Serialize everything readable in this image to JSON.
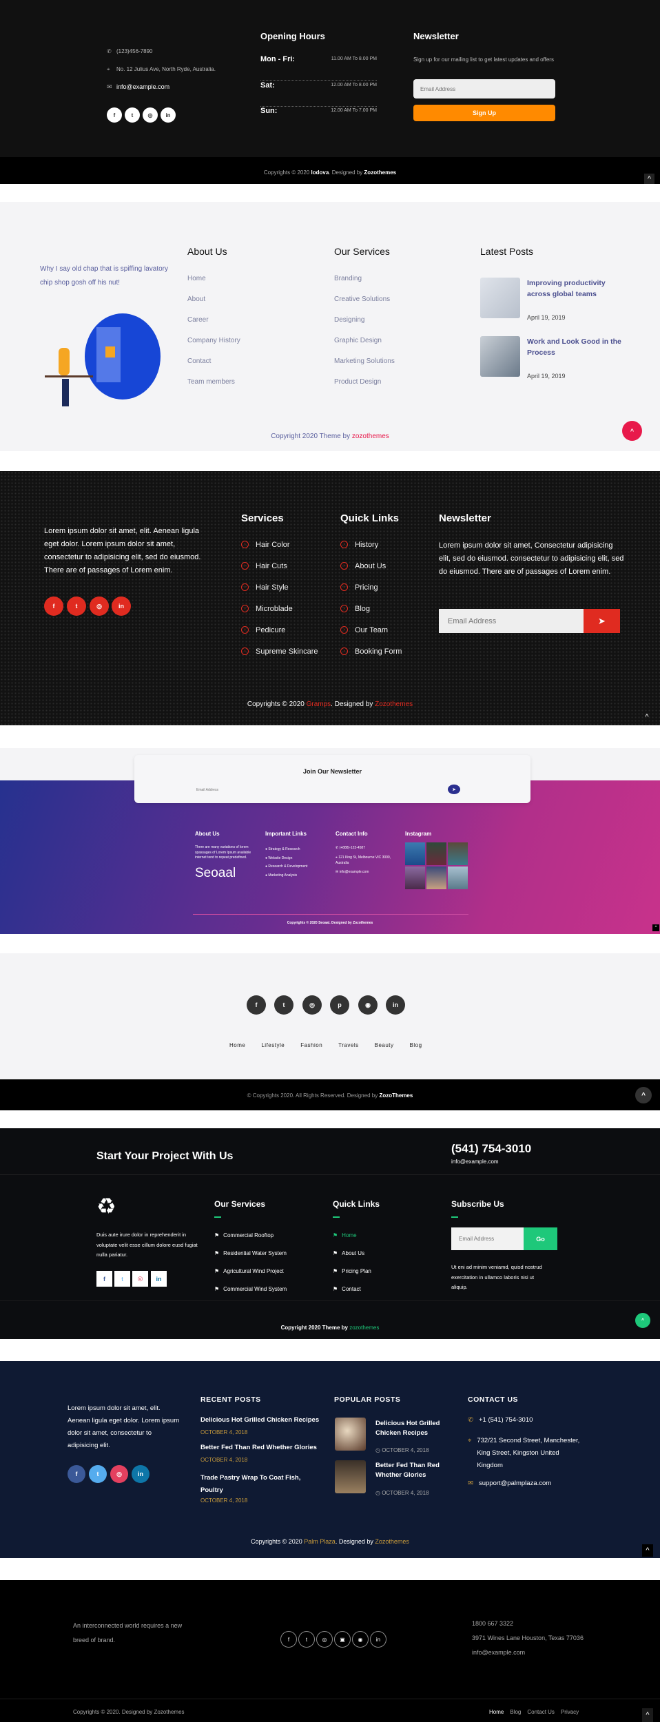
{
  "footer1": {
    "phone": "(123)456-7890",
    "address": "No. 12 Julius Ave, North Ryde, Australia.",
    "email": "info@example.com",
    "social": [
      "f",
      "t",
      "ig",
      "in"
    ],
    "hours_title": "Opening Hours",
    "hours": [
      {
        "day": "Mon - Fri:",
        "time": "11.00 AM To 8.00 PM"
      },
      {
        "day": "Sat:",
        "time": "12.00 AM To 8.00 PM"
      },
      {
        "day": "Sun:",
        "time": "12.00 AM To 7.00 PM"
      }
    ],
    "newsletter_title": "Newsletter",
    "newsletter_text": "Sign up for our mailing list to get latest updates and offers",
    "email_placeholder": "Email Address",
    "signup": "Sign Up",
    "copy_pre": "Copyrights © 2020 ",
    "copy_brand": "lodova",
    "copy_mid": ". Designed by ",
    "copy_designer": "Zozothemes",
    "accent": "#ff8a00"
  },
  "footer2": {
    "tagline": "Why I say old chap that is spiffing lavatory chip shop gosh off his nut!",
    "about_title": "About Us",
    "about_links": [
      "Home",
      "About",
      "Career",
      "Company History",
      "Contact",
      "Team members"
    ],
    "services_title": "Our Services",
    "services_links": [
      "Branding",
      "Creative Solutions",
      "Designing",
      "Graphic Design",
      "Marketing Solutions",
      "Product Design"
    ],
    "posts_title": "Latest Posts",
    "posts": [
      {
        "title": "Improving productivity across global teams",
        "date": "April 19, 2019"
      },
      {
        "title": "Work and Look Good in the Process",
        "date": "April 19, 2019"
      }
    ],
    "copy_pre": "Copyright 2020 Theme by ",
    "copy_link": "zozothemes",
    "accent": "#e8194b"
  },
  "footer3": {
    "about_text": "Lorem ipsum dolor sit amet, elit. Aenean ligula eget dolor. Lorem ipsum dolor sit amet, consectetur to adipisicing elit, sed do eiusmod. There are of passages of Lorem enim.",
    "social": [
      "f",
      "t",
      "ig",
      "in"
    ],
    "services_title": "Services",
    "services": [
      "Hair Color",
      "Hair Cuts",
      "Hair Style",
      "Microblade",
      "Pedicure",
      "Supreme Skincare"
    ],
    "links_title": "Quick Links",
    "links": [
      "History",
      "About Us",
      "Pricing",
      "Blog",
      "Our Team",
      "Booking Form"
    ],
    "newsletter_title": "Newsletter",
    "newsletter_text": "Lorem ipsum dolor sit amet, Consectetur adipisicing elit, sed do eiusmod. consectetur to adipisicing elit, sed do eiusmod. There are of passages of Lorem enim.",
    "email_placeholder": "Email Address",
    "copy_pre": "Copyrights © 2020 ",
    "copy_brand": "Gramps",
    "copy_mid": ". Designed by ",
    "copy_designer": "Zozothemes",
    "accent": "#e02b20"
  },
  "footer4": {
    "newsletter_title": "Join Our Newsletter",
    "email_placeholder": "Email Address",
    "about_title": "About Us",
    "about_text": "There are many variations of lorem spassages of Lorem Ipsum available internet tend to repeat predefined.",
    "logo": "Seoaal",
    "links_title": "Important Links",
    "links": [
      "Strategy & Research",
      "Website Design",
      "Research & Development",
      "Marketing Analysis"
    ],
    "contact_title": "Contact Info",
    "phone": "(+888)-123-4587",
    "address": "121 King St, Melbourne VIC 3000, Australia",
    "email": "info@example.com",
    "instagram_title": "Instagram",
    "copyright": "Copyrights © 2020 Seoaal. Designed by Zozothemes"
  },
  "footer5": {
    "social": [
      "f",
      "t",
      "ig",
      "p",
      "dr",
      "in"
    ],
    "menu": [
      "Home",
      "Lifestyle",
      "Fashion",
      "Travels",
      "Beauty",
      "Blog"
    ],
    "copy_pre": "© Copyrights 2020. All Rights Reserved. Designed by ",
    "copy_designer": "ZozoThemes"
  },
  "footer6": {
    "cta": "Start Your Project With Us",
    "phone": "(541) 754-3010",
    "email": "info@example.com",
    "about_text": "Duis aute irure dolor in reprehenderit in voluptate velit esse cillum dolore eusd fugiat nulla pariatur.",
    "social": [
      "f",
      "t",
      "ig",
      "in"
    ],
    "services_title": "Our Services",
    "services": [
      "Commercial Rooftop",
      "Residential Water System",
      "Agricultural Wind Project",
      "Commercial Wind System"
    ],
    "links_title": "Quick Links",
    "links": [
      "Home",
      "About Us",
      "Pricing Plan",
      "Contact"
    ],
    "subscribe_title": "Subscribe Us",
    "email_placeholder": "Email Address",
    "go": "Go",
    "subscribe_text": "Ut eni ad minim veniamd, quisd nostrud exercitation in ullamco laboris nisi ut aliquip.",
    "copy_pre": "Copyright 2020 Theme by ",
    "copy_link": "zozothemes",
    "accent": "#1ec87a"
  },
  "footer7": {
    "about_text": "Lorem ipsum dolor sit amet, elit. Aenean ligula eget dolor. Lorem ipsum dolor sit amet, consectetur to adipisicing elit.",
    "social": [
      "f",
      "t",
      "ig",
      "in"
    ],
    "recent_title": "RECENT POSTS",
    "recent": [
      {
        "title": "Delicious Hot Grilled Chicken Recipes",
        "date": "OCTOBER 4, 2018"
      },
      {
        "title": "Better Fed Than Red Whether Glories",
        "date": "OCTOBER 4, 2018"
      },
      {
        "title": "Trade Pastry Wrap To Coat Fish, Poultry",
        "date": "OCTOBER 4, 2018"
      }
    ],
    "popular_title": "POPULAR POSTS",
    "popular": [
      {
        "title": "Delicious Hot Grilled Chicken Recipes",
        "date": "OCTOBER 4, 2018"
      },
      {
        "title": "Better Fed Than Red Whether Glories",
        "date": "OCTOBER 4, 2018"
      }
    ],
    "contact_title": "CONTACT US",
    "phone": "+1 (541) 754-3010",
    "address": "732/21 Second Street, Manchester, King Street, Kingston United Kingdom",
    "email": "support@palmplaza.com",
    "copy_pre": "Copyrights © 2020 ",
    "copy_brand": "Palm Plaza",
    "copy_mid": ". Designed by ",
    "copy_designer": "Zozothemes",
    "accent": "#c89b3c"
  },
  "footer8": {
    "tagline": "An interconnected world requires a new breed of brand.",
    "social": [
      "f",
      "t",
      "ig",
      "yt",
      "dr",
      "in"
    ],
    "phone": "1800 667 3322",
    "address": "3971 Wines Lane Houston, Texas 77036",
    "email": "info@example.com",
    "copyright": "Copyrights © 2020. Designed by Zozothemes",
    "links": [
      "Home",
      "Blog",
      "Contact Us",
      "Privacy"
    ]
  }
}
